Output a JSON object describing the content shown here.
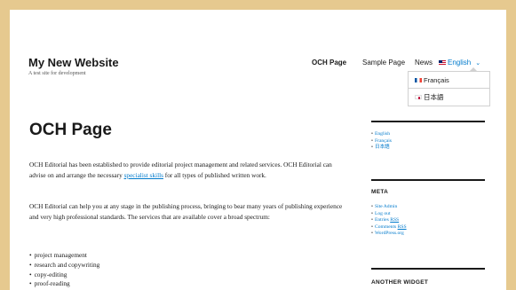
{
  "site": {
    "title": "My New Website",
    "description": "A test site for development"
  },
  "nav": {
    "items": [
      {
        "label": "OCH Page"
      },
      {
        "label": "Sample Page"
      },
      {
        "label": "News"
      }
    ],
    "language": {
      "label": "English",
      "flag": "gb-flag-icon"
    }
  },
  "language_dropdown": {
    "options": [
      {
        "label": "Français",
        "flag": "fr-flag-icon"
      },
      {
        "label": "日本語",
        "flag": "jp-flag-icon"
      }
    ]
  },
  "main": {
    "title": "OCH Page",
    "para1_before": "OCH Editorial has been established to provide editorial project management and related services. OCH Editorial can advise on and arrange the necessary ",
    "para1_link": "specialist skills",
    "para1_after": " for all types of published written work.",
    "para2": "OCH Editorial can help you at any stage in the publishing process, bringing to bear many years of publishing experience and very high professional standards. The services that are available cover a broad spectrum:",
    "services": [
      "project management",
      "research and copywriting",
      "copy-editing",
      "proof-reading"
    ]
  },
  "sidebar": {
    "languages_widget": {
      "items": [
        "English",
        "Français",
        "日本語"
      ]
    },
    "meta_widget": {
      "title": "META",
      "items": [
        {
          "before": "Site Admin",
          "abbr": "",
          "after": ""
        },
        {
          "before": "Log out",
          "abbr": "",
          "after": ""
        },
        {
          "before": "Entries ",
          "abbr": "RSS",
          "after": ""
        },
        {
          "before": "Comments ",
          "abbr": "RSS",
          "after": ""
        },
        {
          "before": "WordPress.org",
          "abbr": "",
          "after": ""
        }
      ]
    },
    "another_widget": {
      "title": "ANOTHER WIDGET"
    }
  },
  "colors": {
    "frame": "#e6c98f",
    "link": "#007acc",
    "text": "#1a1a1a"
  }
}
